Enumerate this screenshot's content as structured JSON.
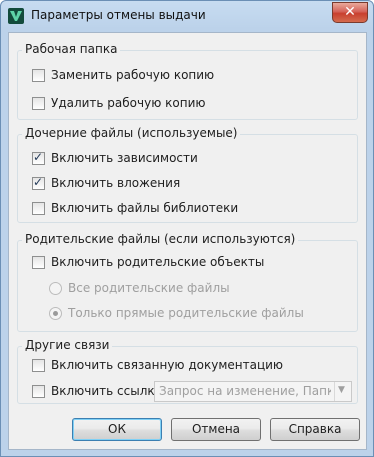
{
  "window": {
    "title": "Параметры отмены выдачи",
    "close_glyph": "✕",
    "icon": "vault-v-icon"
  },
  "groups": {
    "working_folder": {
      "label": "Рабочая папка",
      "items": [
        {
          "label": "Заменить рабочую копию",
          "checked": false
        },
        {
          "label": "Удалить рабочую копию",
          "checked": false
        }
      ]
    },
    "children": {
      "label": "Дочерние файлы (используемые)",
      "items": [
        {
          "label": "Включить зависимости",
          "checked": true
        },
        {
          "label": "Включить вложения",
          "checked": true
        },
        {
          "label": "Включить файлы библиотеки",
          "checked": false
        }
      ]
    },
    "parents": {
      "label": "Родительские файлы (если используются)",
      "include": {
        "label": "Включить родительские объекты",
        "checked": false
      },
      "radios": [
        {
          "label": "Все родительские файлы",
          "selected": false,
          "enabled": false
        },
        {
          "label": "Только прямые родительские файлы",
          "selected": true,
          "enabled": false
        }
      ]
    },
    "other": {
      "label": "Другие связи",
      "include_docs": {
        "label": "Включить связанную документацию",
        "checked": false
      },
      "include_links": {
        "label": "Включить ссылки",
        "checked": false
      },
      "links_select": {
        "value": "Запрос на изменение, Папка, ...",
        "enabled": false
      }
    }
  },
  "buttons": {
    "ok": "ОК",
    "cancel": "Отмена",
    "help": "Справка"
  },
  "colors": {
    "title_bar": "#bcd2ea",
    "close_button": "#c8402f",
    "dialog_bg": "#f0f0f0",
    "default_button_border": "#3c7fb1"
  }
}
